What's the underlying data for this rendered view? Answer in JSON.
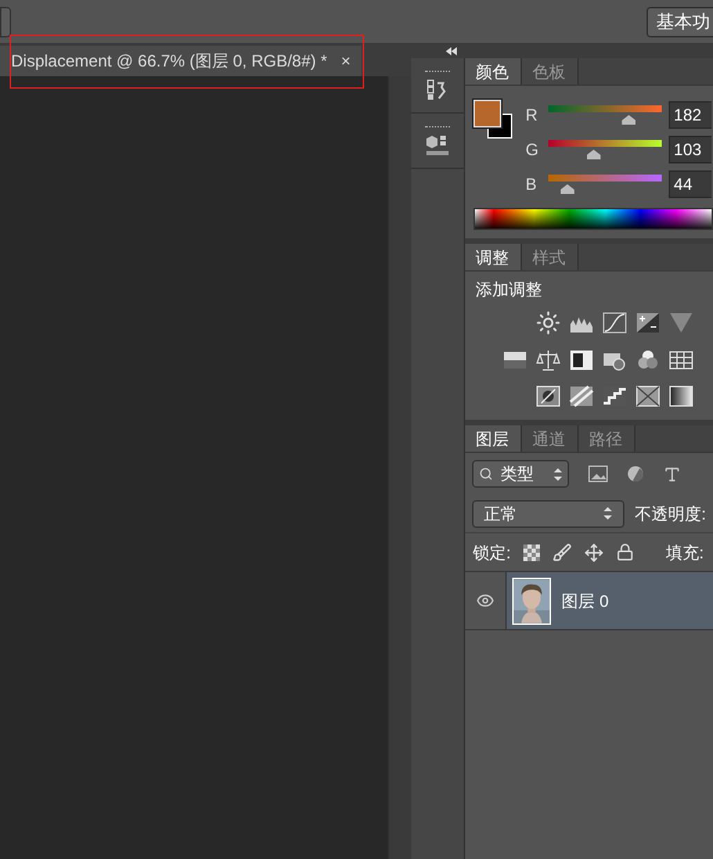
{
  "top_bar": {
    "workspace_button": "基本功"
  },
  "document_tab": {
    "title": "Displacement @ 66.7% (图层 0, RGB/8#) *",
    "close": "×",
    "selected": true
  },
  "color_panel": {
    "tabs": [
      {
        "label": "颜色",
        "selected": true
      },
      {
        "label": "色板",
        "selected": false
      }
    ],
    "channels": [
      {
        "name": "R",
        "level": 0.714,
        "value": "182"
      },
      {
        "name": "G",
        "level": 0.404,
        "value": "103"
      },
      {
        "name": "B",
        "level": 0.173,
        "value": "44"
      }
    ]
  },
  "adjustments_panel": {
    "tabs": [
      {
        "label": "调整",
        "selected": true
      },
      {
        "label": "样式",
        "selected": false
      }
    ],
    "heading": "添加调整"
  },
  "layers_panel": {
    "tabs": [
      {
        "label": "图层",
        "selected": true
      },
      {
        "label": "通道",
        "selected": false
      },
      {
        "label": "路径",
        "selected": false
      }
    ],
    "filter": "类型",
    "blend_mode": "正常",
    "opacity_label": "不透明度:",
    "lock_label": "锁定:",
    "fill_label": "填充:",
    "layers": [
      {
        "name": "图层 0",
        "visible": true,
        "selected": true,
        "kind": "picture"
      }
    ]
  }
}
